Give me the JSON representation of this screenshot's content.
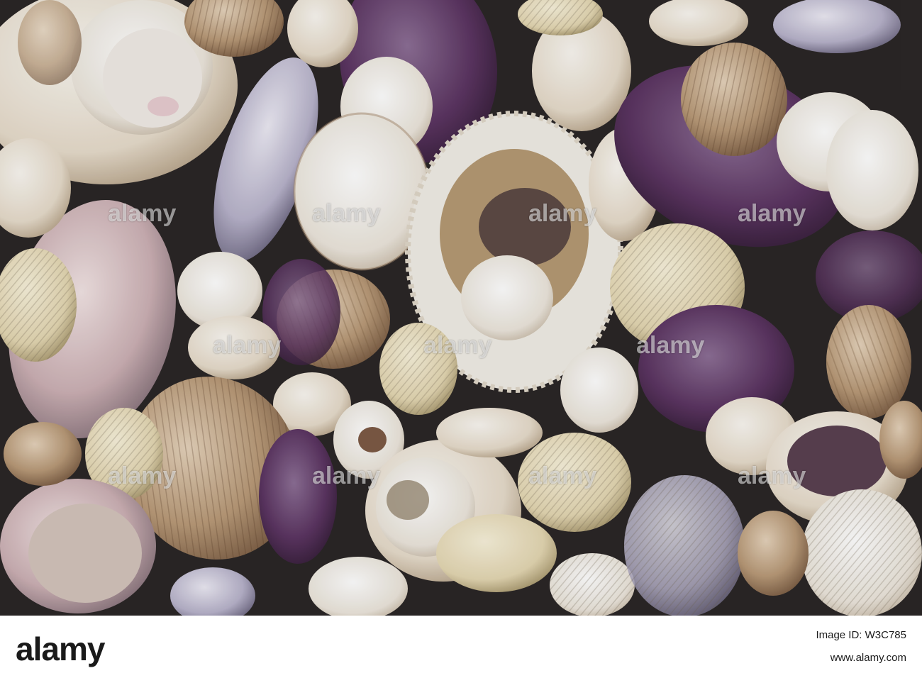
{
  "photo": {
    "subject": "assorted seashells",
    "watermark_text": "alamy"
  },
  "footer": {
    "logo_text": "alamy",
    "image_id_label": "Image ID: W3C785",
    "site_url": "www.alamy.com"
  },
  "colors": {
    "background_dark": "#2a2626",
    "shell_cream": "#ece4d6",
    "shell_white": "#f3efe8",
    "shell_tan": "#b79878",
    "shell_brown": "#8b6a4f",
    "shell_purple": "#5c3560",
    "shell_lavender": "#b9b5cc",
    "footer_bg": "#ffffff",
    "footer_text": "#1a1a1a"
  }
}
